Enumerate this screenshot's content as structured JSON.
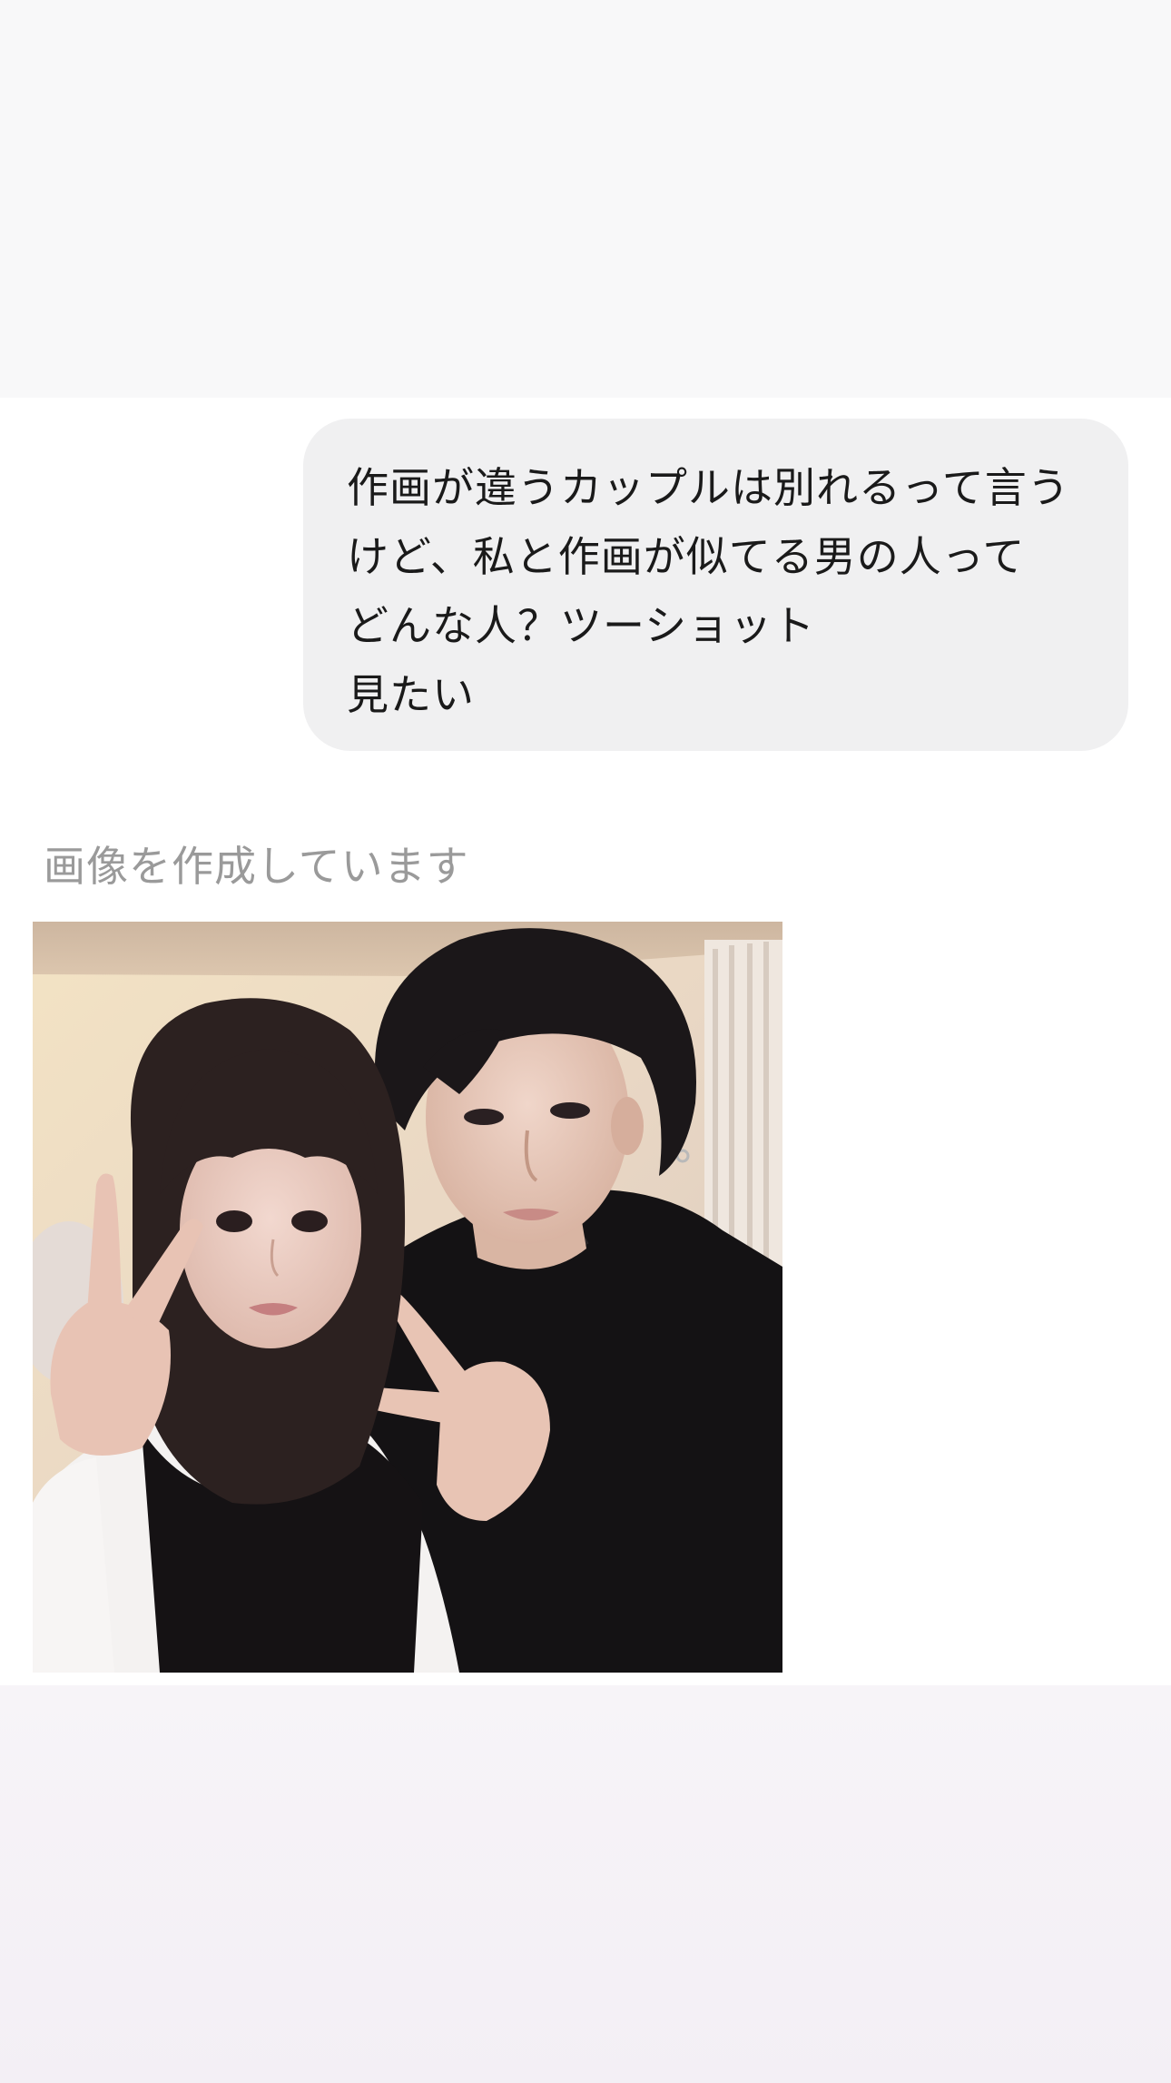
{
  "chat": {
    "user_message": {
      "lines": [
        "作画が違うカップルは別れるって言う",
        "けど、私と作画が似てる男の人って",
        "どんな人？ツーショット",
        "見たい"
      ]
    },
    "assistant": {
      "status_text": "画像を作成しています",
      "image": {
        "description_icon": "generated-photo"
      }
    }
  }
}
